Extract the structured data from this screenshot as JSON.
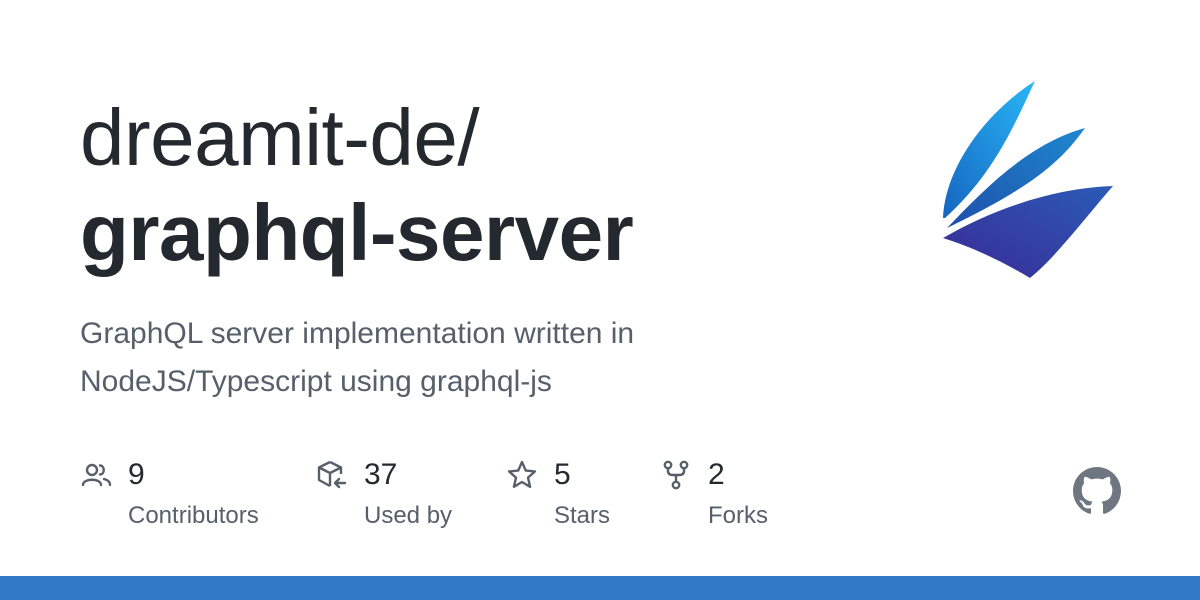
{
  "repo": {
    "owner": "dreamit-de/",
    "name": "graphql-server",
    "description": "GraphQL server implementation written in NodeJS/Typescript using graphql-js"
  },
  "stats": [
    {
      "icon": "people-icon",
      "value": "9",
      "label": "Contributors"
    },
    {
      "icon": "package-dependents-icon",
      "value": "37",
      "label": "Used by"
    },
    {
      "icon": "star-icon",
      "value": "5",
      "label": "Stars"
    },
    {
      "icon": "repo-forked-icon",
      "value": "2",
      "label": "Forks"
    }
  ],
  "colors": {
    "bar": "#3178c6",
    "icon": "#57606a",
    "github_logo": "#6e7781",
    "logo_light": "#29a8e0",
    "logo_mid": "#1e6bb8",
    "logo_dark": "#3a2f9a"
  }
}
